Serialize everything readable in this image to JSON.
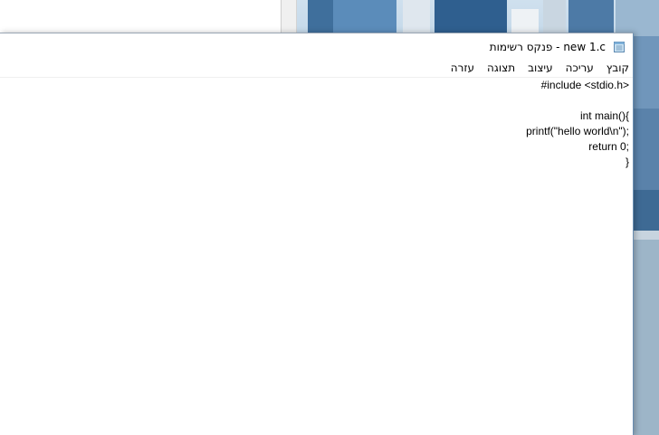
{
  "window": {
    "title": "new 1.c - פנקס רשימות",
    "icon": "notepad-icon"
  },
  "menu": {
    "items": [
      "קובץ",
      "עריכה",
      "עיצוב",
      "תצוגה",
      "עזרה"
    ]
  },
  "editor": {
    "lines": [
      "#include <stdio.h>",
      "",
      "int main(){",
      "  printf(\"hello world\\n\");",
      "  return 0;",
      "}"
    ]
  },
  "colors": {
    "accent": "#6b8fb3",
    "background": "#ffffff",
    "text": "#000000"
  }
}
